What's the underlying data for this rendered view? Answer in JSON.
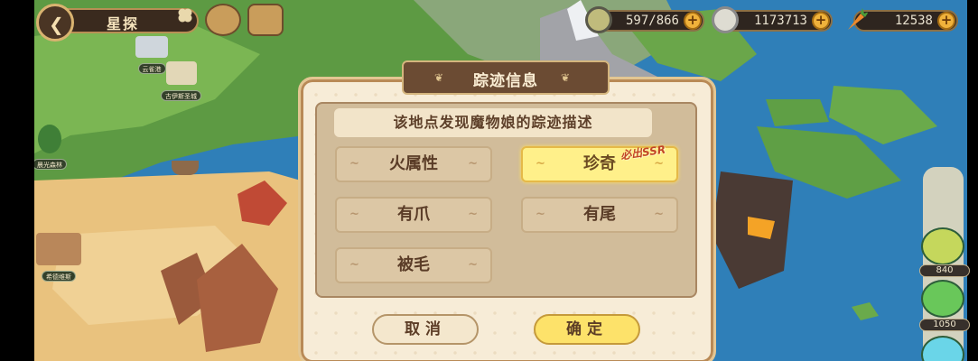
{
  "header": {
    "title": "星探"
  },
  "resources": [
    {
      "name": "stamina",
      "value": "597/866",
      "icon": "cup-icon"
    },
    {
      "name": "coins",
      "value": "1173713",
      "icon": "coin-icon"
    },
    {
      "name": "carrots",
      "value": "12538",
      "icon": "carrot-icon"
    }
  ],
  "map_locations": [
    {
      "label": "云雀港"
    },
    {
      "label": "古伊斯圣城"
    },
    {
      "label": "晨光森林"
    },
    {
      "label": "希德维斯"
    }
  ],
  "monsters": [
    {
      "level": "840"
    },
    {
      "level": "1050"
    }
  ],
  "dialog": {
    "title": "踪迹信息",
    "subtitle": "该地点发现魔物娘的踪迹描述",
    "tags": [
      "火属性",
      "珍奇",
      "有爪",
      "有尾",
      "被毛"
    ],
    "selected_tag": "珍奇",
    "badge": "必出SSR",
    "cancel_label": "取消",
    "confirm_label": "确定"
  },
  "colors": {
    "sea": "#2f7fb8",
    "land": "#6aa64a",
    "desert": "#e9c27e",
    "dialog_bg": "#f7ecd7",
    "header_bg": "#6b4b33",
    "selected_tag": "#fff08a"
  }
}
